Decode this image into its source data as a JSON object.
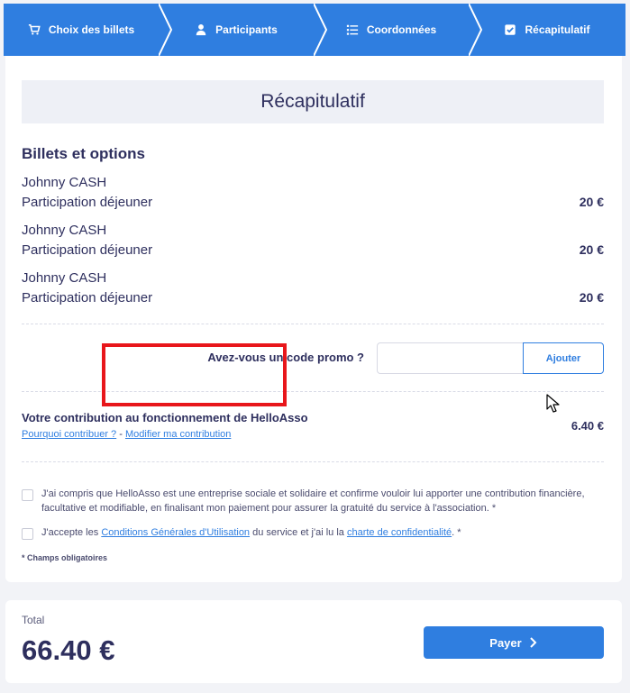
{
  "stepper": {
    "steps": [
      {
        "label": "Choix des billets",
        "icon": "cart-icon"
      },
      {
        "label": "Participants",
        "icon": "user-icon"
      },
      {
        "label": "Coordonnées",
        "icon": "list-icon"
      },
      {
        "label": "Récapitulatif",
        "icon": "checkbox-icon"
      }
    ],
    "color": "#2f7ee0"
  },
  "summary": {
    "title": "Récapitulatif",
    "section_title": "Billets et options",
    "tickets": [
      {
        "name": "Johnny CASH",
        "option": "Participation déjeuner",
        "price": "20 €"
      },
      {
        "name": "Johnny CASH",
        "option": "Participation déjeuner",
        "price": "20 €"
      },
      {
        "name": "Johnny CASH",
        "option": "Participation déjeuner",
        "price": "20 €"
      }
    ]
  },
  "promo": {
    "label": "Avez-vous un code promo ?",
    "input_value": "",
    "button_label": "Ajouter"
  },
  "contribution": {
    "title": "Votre contribution au fonctionnement de HelloAsso",
    "why_link": "Pourquoi contribuer ?",
    "separator": "-",
    "modify_link": "Modifier ma contribution",
    "amount": "6.40 €"
  },
  "consents": {
    "consent1": "J'ai compris que HelloAsso est une entreprise sociale et solidaire et confirme vouloir lui apporter une contribution financière, facultative et modifiable, en finalisant mon paiement pour assurer la gratuité du service à l'association. *",
    "consent2_prefix": "J'accepte les",
    "consent2_cgu_link": "Conditions Générales d'Utilisation",
    "consent2_middle": "du service et j'ai lu la",
    "consent2_privacy_link": "charte de confidentialité",
    "consent2_suffix": ". *",
    "required_note": "* Champs obligatoires"
  },
  "total": {
    "label": "Total",
    "value": "66.40 €",
    "pay_label": "Payer"
  },
  "colors": {
    "accent": "#2f7ee0",
    "text": "#2e2f5e",
    "highlight": "#e8161b"
  }
}
